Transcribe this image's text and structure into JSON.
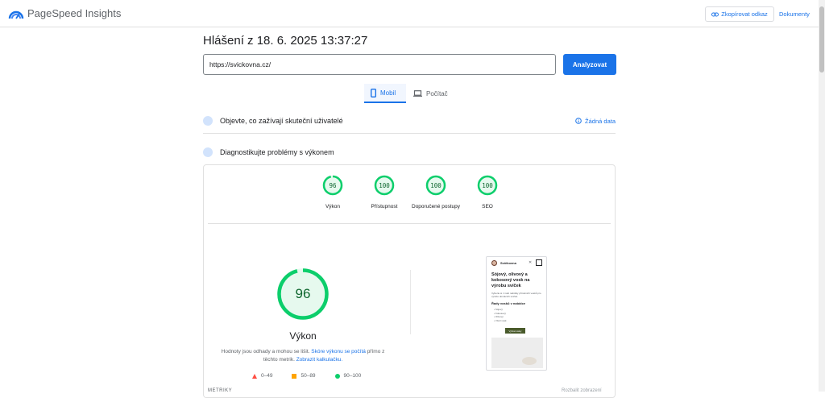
{
  "app": {
    "title": "PageSpeed Insights",
    "logo_icon": "pagespeed-logo-icon"
  },
  "header": {
    "copy_link_label": "Zkopírovat odkaz",
    "docs_label": "Dokumenty"
  },
  "report": {
    "title": "Hlášení z 18. 6. 2025 13:37:27",
    "url_value": "https://svickovna.cz/",
    "analyze_label": "Analyzovat"
  },
  "tabs": [
    {
      "label": "Mobil",
      "selected": true,
      "icon": "smartphone-icon"
    },
    {
      "label": "Počítač",
      "selected": false,
      "icon": "laptop-icon"
    }
  ],
  "sections": {
    "real_users_label": "Objevte, co zažívají skuteční uživatelé",
    "no_data_label": "Žádná data",
    "diagnose_label": "Diagnostikujte problémy s výkonem"
  },
  "scores": [
    {
      "value": "96",
      "label": "Výkon",
      "fraction": 0.96
    },
    {
      "value": "100",
      "label": "Přístupnost",
      "fraction": 1.0
    },
    {
      "value": "100",
      "label": "Doporučené postupy",
      "fraction": 1.0
    },
    {
      "value": "100",
      "label": "SEO",
      "fraction": 1.0
    }
  ],
  "performance": {
    "score": "96",
    "fraction": 0.96,
    "label": "Výkon",
    "desc_prefix": "Hodnoty jsou odhady a mohou se lišit.",
    "desc_link1": "Skóre výkonu se počítá",
    "desc_middle": "přímo z těchto metrik.",
    "desc_link2": "Zobrazit kalkulačku.",
    "legend": [
      "0–49",
      "50–89",
      "90–100"
    ]
  },
  "preview": {
    "brand": "Svíčkovna",
    "heading": "Sójový, olivový a kokosový vosk na výrobu svíček",
    "paragraph": "Vyberte si z naší nabídky přírodních vosků pro výrobu domácích svíček.",
    "subheading": "Řady vosků v nabídce",
    "list": [
      "• Sójový",
      "• Kokosový",
      "• Olivový",
      "• Včelí vosk"
    ],
    "button": "Vybrat vosky"
  },
  "metrics": {
    "label": "METRIKY",
    "right_label": "Rozbalit zobrazení"
  },
  "colors": {
    "accent": "#1a73e8",
    "pass": "#0cce6b",
    "pass_text": "#0d652d",
    "average": "#ffa400",
    "fail": "#ff4e42"
  }
}
